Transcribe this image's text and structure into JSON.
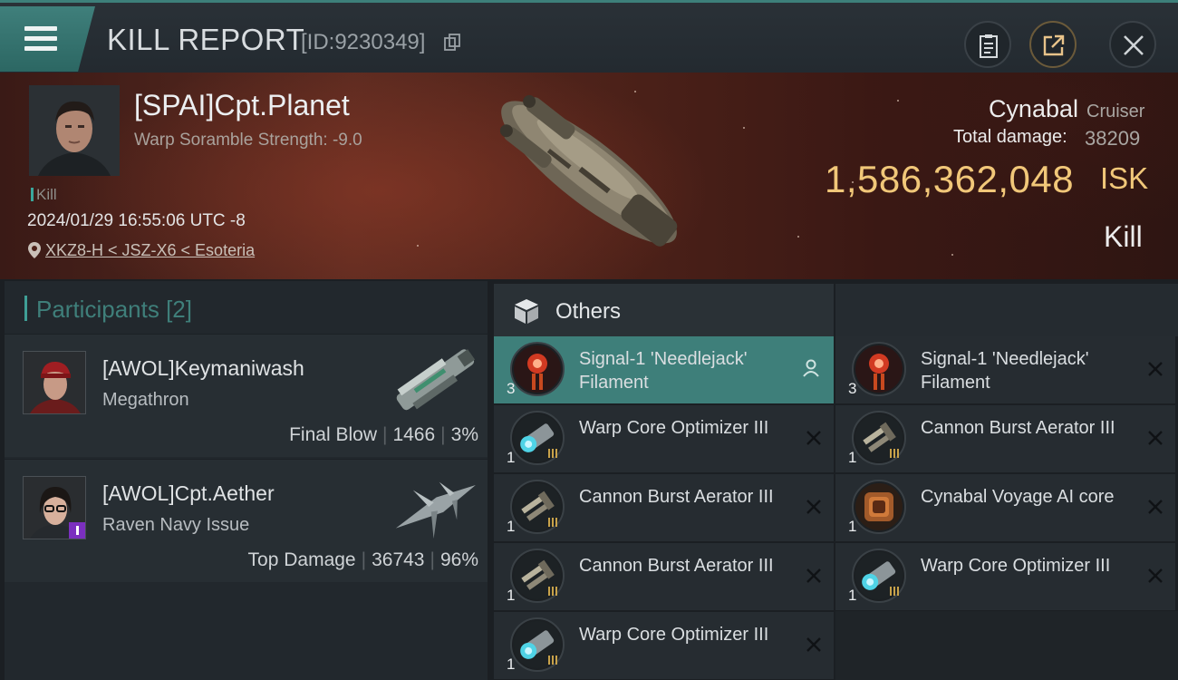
{
  "header": {
    "title": "KILL REPORT",
    "report_id": "[ID:9230349]",
    "icons": [
      "menu-icon",
      "copy-icon",
      "clipboard-icon",
      "share-icon",
      "close-icon"
    ]
  },
  "victim": {
    "name": "[SPAI]Cpt.Planet",
    "subtitle": "Warp Soramble Strength: -9.0",
    "tag": "Kill",
    "datetime": "2024/01/29 16:55:06 UTC -8",
    "location": "XKZ8-H < JSZ-X6 < Esoteria",
    "ship_name": "Cynabal",
    "ship_class": "Cruiser",
    "damage_label": "Total damage:",
    "damage_value": "38209",
    "isk_value": "1,586,362,048",
    "isk_unit": "ISK",
    "result": "Kill"
  },
  "participants": {
    "label": "Participants",
    "count": "[2]",
    "rows": [
      {
        "name": "[AWOL]Keymaniwash",
        "ship": "Megathron",
        "role": "Final Blow",
        "damage": "1466",
        "percent": "3%"
      },
      {
        "name": "[AWOL]Cpt.Aether",
        "ship": "Raven Navy Issue",
        "role": "Top Damage",
        "damage": "36743",
        "percent": "96%"
      }
    ]
  },
  "others": {
    "title": "Others",
    "left": [
      {
        "qty": "3",
        "name": "Signal-1 'Needlejack' Filament",
        "kind": "filament",
        "selected": true
      },
      {
        "qty": "1",
        "name": "Warp Core Optimizer III",
        "kind": "optimizer"
      },
      {
        "qty": "1",
        "name": "Cannon Burst Aerator III",
        "kind": "aerator"
      },
      {
        "qty": "1",
        "name": "Cannon Burst Aerator III",
        "kind": "aerator"
      },
      {
        "qty": "1",
        "name": "Warp Core Optimizer III",
        "kind": "optimizer"
      }
    ],
    "right": [
      {
        "qty": "3",
        "name": "Signal-1 'Needlejack' Filament",
        "kind": "filament"
      },
      {
        "qty": "1",
        "name": "Cannon Burst Aerator III",
        "kind": "aerator"
      },
      {
        "qty": "1",
        "name": "Cynabal Voyage AI core",
        "kind": "core"
      },
      {
        "qty": "1",
        "name": "Warp Core Optimizer III",
        "kind": "optimizer"
      }
    ]
  },
  "colors": {
    "accent_teal": "#3e7f7a",
    "isk_gold": "#f1c779",
    "banner_red": "#5a2a20"
  }
}
